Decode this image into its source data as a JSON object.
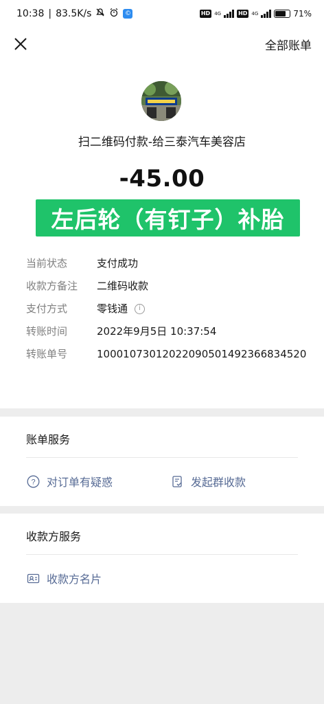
{
  "status_bar": {
    "time": "10:38",
    "speed": "83.5K/s",
    "hd1": "HD",
    "net1": "4G",
    "hd2": "HD",
    "net2": "4G",
    "battery": "71"
  },
  "navbar": {
    "close_icon": "close-icon",
    "right_label": "全部账单"
  },
  "transaction": {
    "merchant": "扫二维码付款-给三泰汽车美容店",
    "amount": "-45.00",
    "overlay_note": "左后轮（有钉子）补胎",
    "details": [
      {
        "label": "当前状态",
        "value": "支付成功"
      },
      {
        "label": "收款方备注",
        "value": "二维码收款"
      },
      {
        "label": "支付方式",
        "value": "零钱通"
      },
      {
        "label": "转账时间",
        "value": "2022年9月5日 10:37:54"
      },
      {
        "label": "转账单号",
        "value": "100010730120220905014923668345​20"
      }
    ]
  },
  "bill_services": {
    "title": "账单服务",
    "actions": [
      {
        "label": "对订单有疑惑",
        "icon": "question-circle-icon"
      },
      {
        "label": "发起群收款",
        "icon": "group-collect-icon"
      }
    ]
  },
  "payee_services": {
    "title": "收款方服务",
    "actions": [
      {
        "label": "收款方名片",
        "icon": "business-card-icon"
      }
    ]
  },
  "colors": {
    "link": "#576b95",
    "overlay_bg": "#1fc36a",
    "page_bg": "#ededed"
  }
}
